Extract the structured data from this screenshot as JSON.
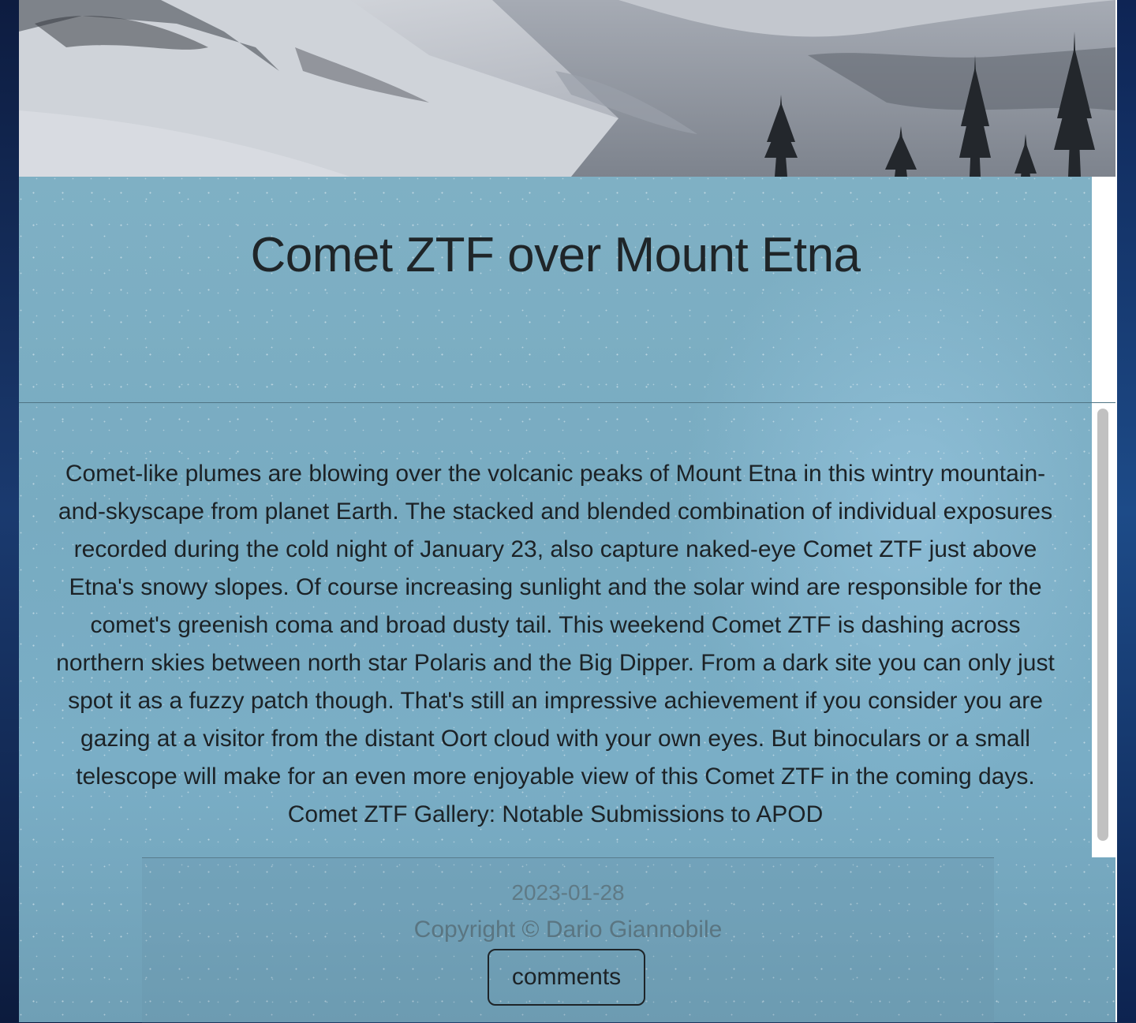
{
  "hero": {
    "image_alt": "Snowy slopes of Mount Etna with pine trees"
  },
  "title": "Comet ZTF over Mount Etna",
  "explanation": "Comet-like plumes are blowing over the volcanic peaks of Mount Etna in this wintry mountain-and-skyscape from planet Earth. The stacked and blended combination of individual exposures recorded during the cold night of January 23, also capture naked-eye Comet ZTF just above Etna's snowy slopes. Of course increasing sunlight and the solar wind are responsible for the comet's greenish coma and broad dusty tail. This weekend Comet ZTF is dashing across northern skies between north star Polaris and the Big Dipper. From a dark site you can only just spot it as a fuzzy patch though. That's still an impressive achievement if you consider you are gazing at a visitor from the distant Oort cloud with your own eyes. But binoculars or a small telescope will make for an even more enjoyable view of this Comet ZTF in the coming days. Comet ZTF Gallery: Notable Submissions to APOD",
  "footer": {
    "date": "2023-01-28",
    "copyright": "Copyright © Dario Giannobile",
    "comments_label": "comments"
  },
  "colors": {
    "panel": "#7aaec6",
    "text": "#1c2226",
    "muted_text": "#5a7581",
    "scroll_thumb": "#c1c1c1"
  }
}
